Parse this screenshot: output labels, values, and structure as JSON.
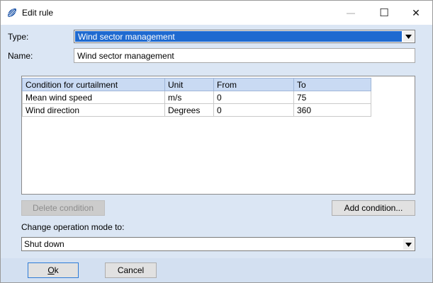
{
  "window": {
    "title": "Edit rule",
    "minimize_glyph": "—",
    "maximize_glyph": "☐",
    "close_glyph": "✕"
  },
  "form": {
    "type_label": "Type:",
    "type_value": "Wind sector management",
    "name_label": "Name:",
    "name_value": "Wind sector management"
  },
  "conditions": {
    "headers": [
      "Condition for curtailment",
      "Unit",
      "From",
      "To"
    ],
    "rows": [
      [
        "Mean wind speed",
        "m/s",
        "0",
        "75"
      ],
      [
        "Wind direction",
        "Degrees",
        "0",
        "360"
      ]
    ]
  },
  "actions": {
    "delete_condition": "Delete condition",
    "add_condition": "Add condition..."
  },
  "operation_mode": {
    "label": "Change operation mode to:",
    "value": "Shut down"
  },
  "footer": {
    "ok_mnemonic": "O",
    "ok_rest": "k",
    "cancel": "Cancel"
  },
  "colors": {
    "selection": "#1f6ad0",
    "dialog_background": "#dbe6f4",
    "grid_header": "#c9daf3"
  },
  "icons": {
    "app": "shell-fan-icon",
    "dropdown": "triangle-down-icon"
  }
}
